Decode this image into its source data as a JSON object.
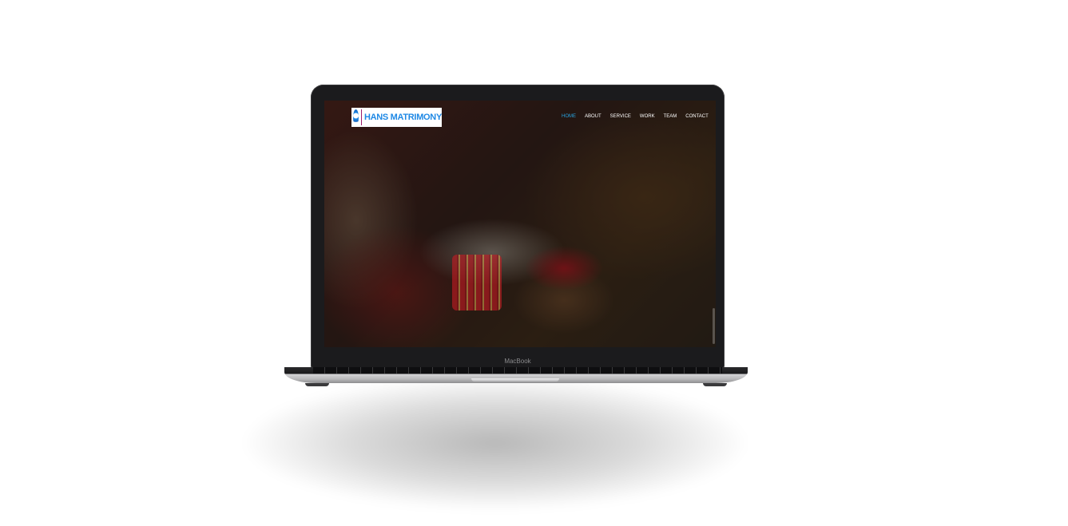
{
  "laptop": {
    "brand_label": "MacBook"
  },
  "site": {
    "logo_text": "HANS MATRIMONY",
    "logo_icon": "logo-emblem-icon",
    "accent_color": "#29a3e0",
    "nav": [
      {
        "label": "HOME",
        "active": true
      },
      {
        "label": "ABOUT",
        "active": false
      },
      {
        "label": "SERVICE",
        "active": false
      },
      {
        "label": "WORK",
        "active": false
      },
      {
        "label": "TEAM",
        "active": false
      },
      {
        "label": "CONTACT",
        "active": false
      }
    ]
  }
}
